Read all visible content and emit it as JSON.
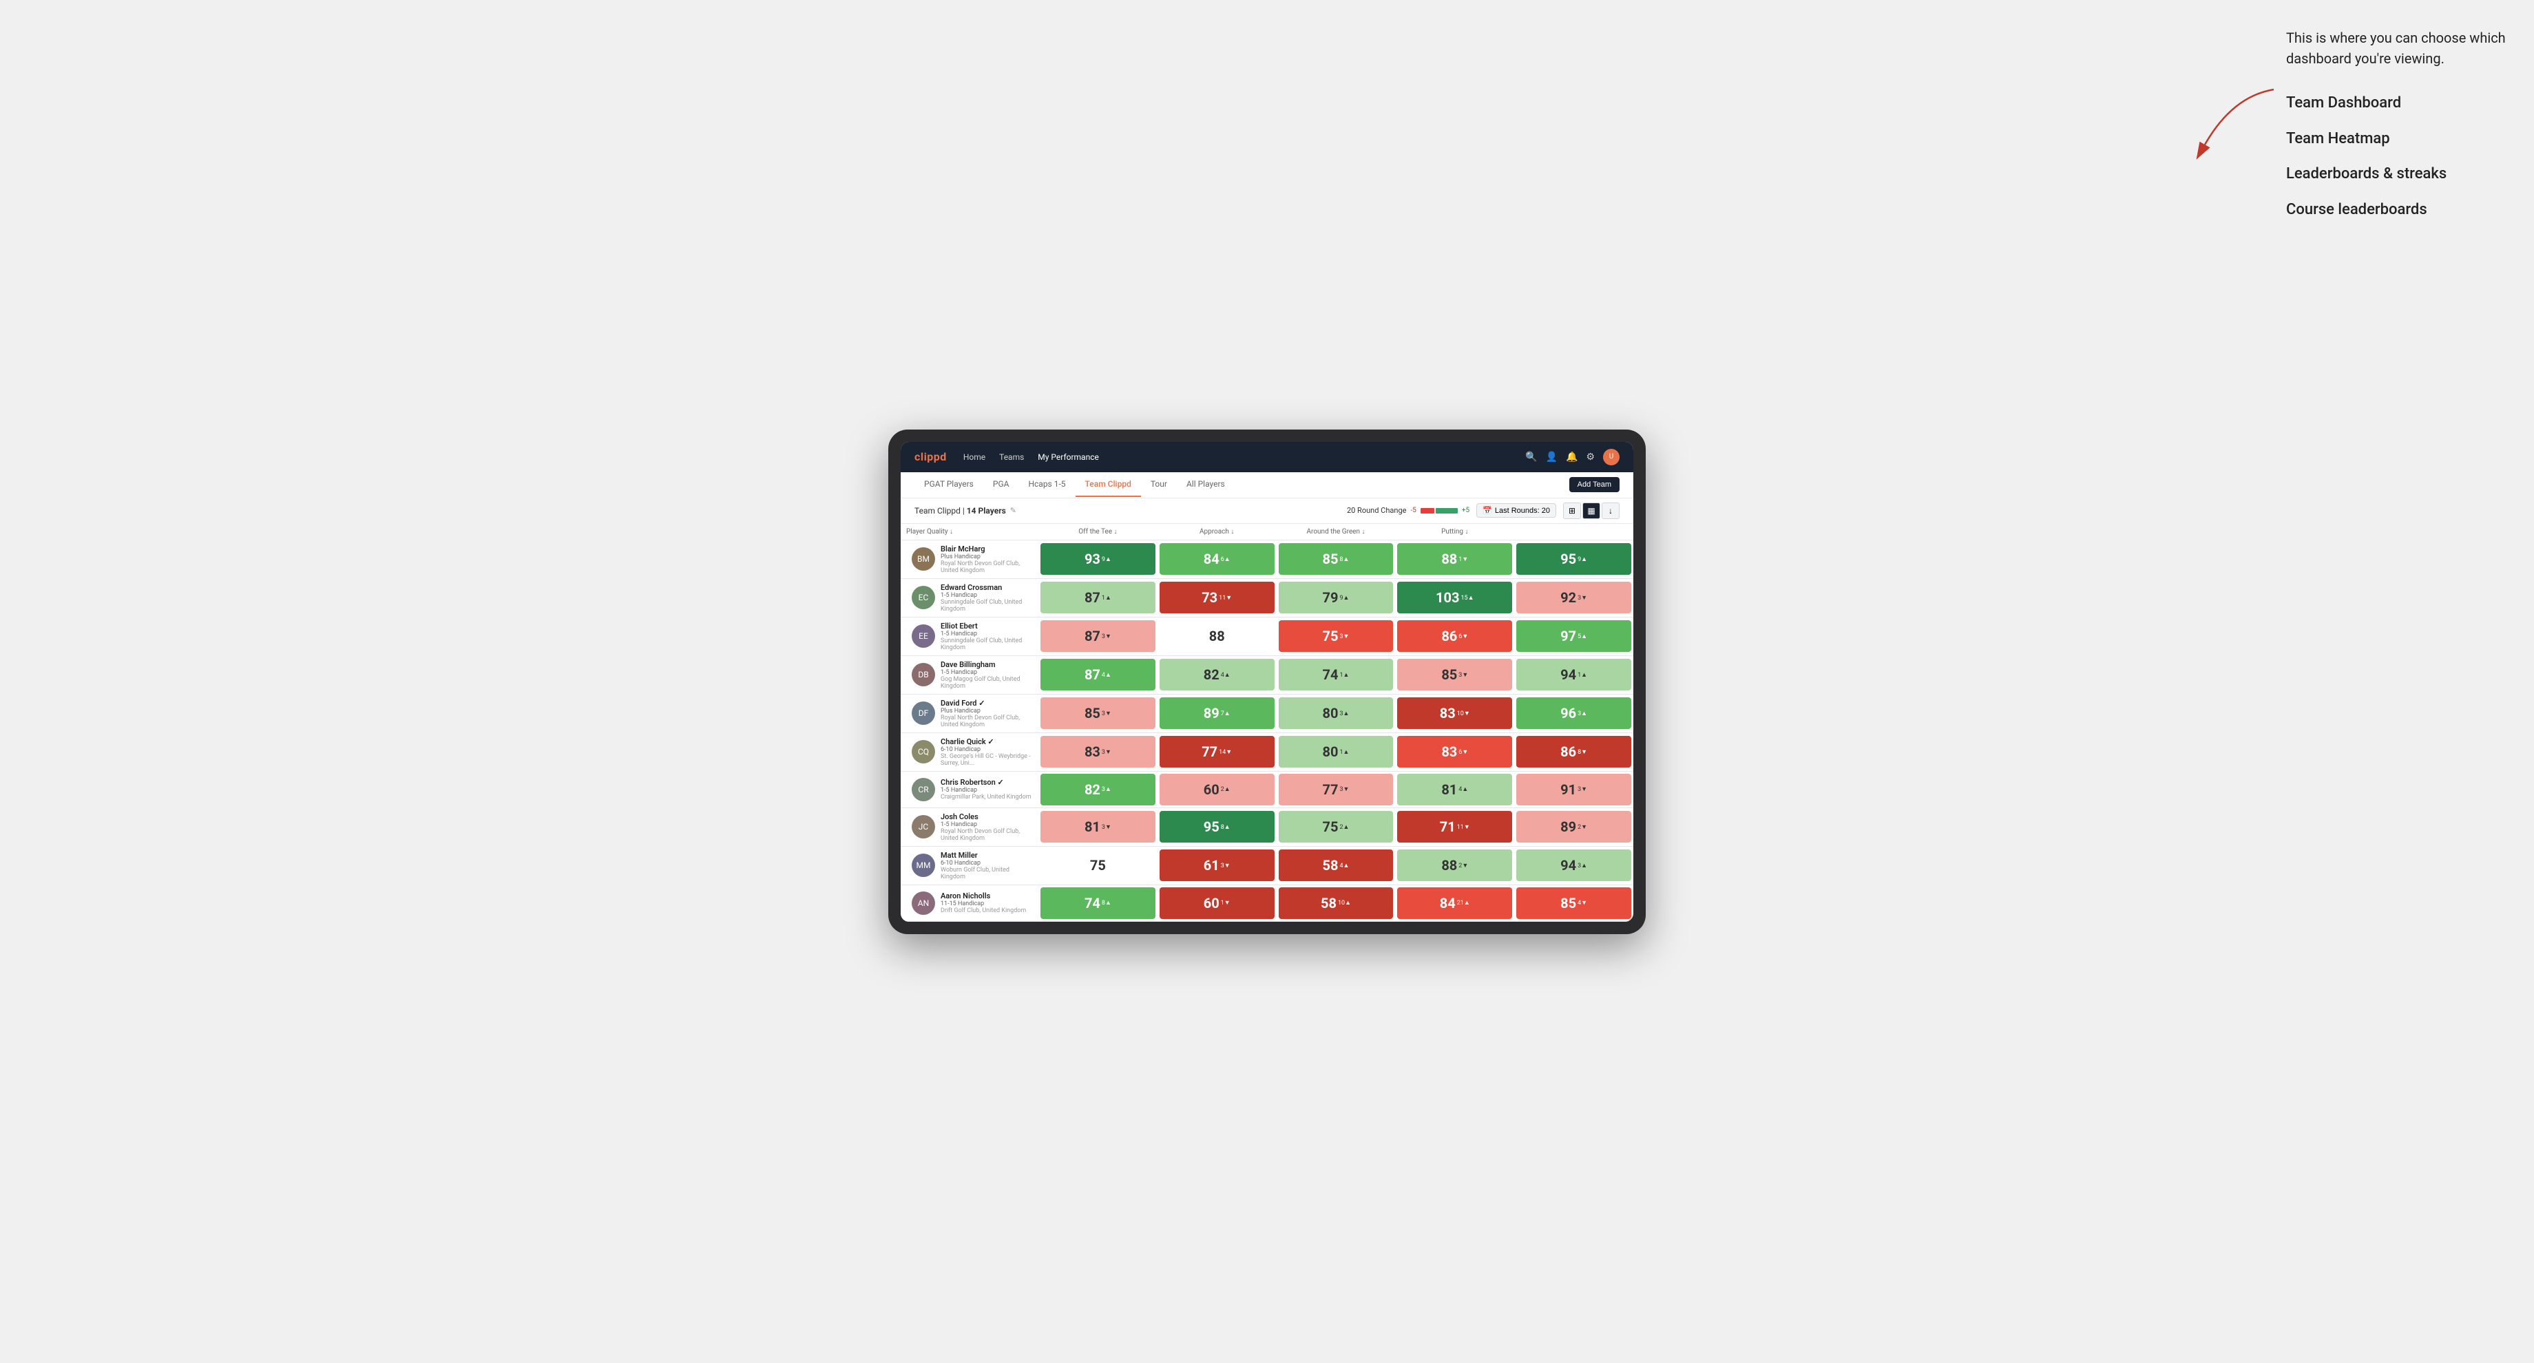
{
  "annotation": {
    "intro": "This is where you can choose which dashboard you're viewing.",
    "items": [
      "Team Dashboard",
      "Team Heatmap",
      "Leaderboards & streaks",
      "Course leaderboards"
    ]
  },
  "nav": {
    "logo": "clippd",
    "links": [
      "Home",
      "Teams",
      "My Performance"
    ],
    "active_link": "My Performance"
  },
  "sub_nav": {
    "tabs": [
      "PGAT Players",
      "PGA",
      "Hcaps 1-5",
      "Team Clippd",
      "Tour",
      "All Players"
    ],
    "active_tab": "Team Clippd",
    "add_team_label": "Add Team"
  },
  "team_info": {
    "name": "Team Clippd",
    "player_count": "14 Players",
    "round_change_label": "20 Round Change",
    "change_neg": "-5",
    "change_pos": "+5",
    "last_rounds_label": "Last Rounds:",
    "last_rounds_value": "20"
  },
  "table": {
    "columns": [
      "Player Quality ↓",
      "Off the Tee ↓",
      "Approach ↓",
      "Around the Green ↓",
      "Putting ↓"
    ],
    "rows": [
      {
        "name": "Blair McHarg",
        "handicap": "Plus Handicap",
        "club": "Royal North Devon Golf Club, United Kingdom",
        "scores": [
          {
            "value": "93",
            "change": "9▲",
            "bg": "bg-green-dark"
          },
          {
            "value": "84",
            "change": "6▲",
            "bg": "bg-green"
          },
          {
            "value": "85",
            "change": "8▲",
            "bg": "bg-green"
          },
          {
            "value": "88",
            "change": "1▼",
            "bg": "bg-green"
          },
          {
            "value": "95",
            "change": "9▲",
            "bg": "bg-green-dark"
          }
        ]
      },
      {
        "name": "Edward Crossman",
        "handicap": "1-5 Handicap",
        "club": "Sunningdale Golf Club, United Kingdom",
        "scores": [
          {
            "value": "87",
            "change": "1▲",
            "bg": "bg-green-light"
          },
          {
            "value": "73",
            "change": "11▼",
            "bg": "bg-red-dark"
          },
          {
            "value": "79",
            "change": "9▲",
            "bg": "bg-green-light"
          },
          {
            "value": "103",
            "change": "15▲",
            "bg": "bg-green-dark"
          },
          {
            "value": "92",
            "change": "3▼",
            "bg": "bg-red-light"
          }
        ]
      },
      {
        "name": "Elliot Ebert",
        "handicap": "1-5 Handicap",
        "club": "Sunningdale Golf Club, United Kingdom",
        "scores": [
          {
            "value": "87",
            "change": "3▼",
            "bg": "bg-red-light"
          },
          {
            "value": "88",
            "change": "",
            "bg": "bg-white"
          },
          {
            "value": "75",
            "change": "3▼",
            "bg": "bg-red"
          },
          {
            "value": "86",
            "change": "6▼",
            "bg": "bg-red"
          },
          {
            "value": "97",
            "change": "5▲",
            "bg": "bg-green"
          }
        ]
      },
      {
        "name": "Dave Billingham",
        "handicap": "1-5 Handicap",
        "club": "Gog Magog Golf Club, United Kingdom",
        "scores": [
          {
            "value": "87",
            "change": "4▲",
            "bg": "bg-green"
          },
          {
            "value": "82",
            "change": "4▲",
            "bg": "bg-green-light"
          },
          {
            "value": "74",
            "change": "1▲",
            "bg": "bg-green-light"
          },
          {
            "value": "85",
            "change": "3▼",
            "bg": "bg-red-light"
          },
          {
            "value": "94",
            "change": "1▲",
            "bg": "bg-green-light"
          }
        ]
      },
      {
        "name": "David Ford",
        "handicap": "Plus Handicap",
        "club": "Royal North Devon Golf Club, United Kingdom",
        "verified": true,
        "scores": [
          {
            "value": "85",
            "change": "3▼",
            "bg": "bg-red-light"
          },
          {
            "value": "89",
            "change": "7▲",
            "bg": "bg-green"
          },
          {
            "value": "80",
            "change": "3▲",
            "bg": "bg-green-light"
          },
          {
            "value": "83",
            "change": "10▼",
            "bg": "bg-red-dark"
          },
          {
            "value": "96",
            "change": "3▲",
            "bg": "bg-green"
          }
        ]
      },
      {
        "name": "Charlie Quick",
        "handicap": "6-10 Handicap",
        "club": "St. George's Hill GC - Weybridge - Surrey, Uni...",
        "verified": true,
        "scores": [
          {
            "value": "83",
            "change": "3▼",
            "bg": "bg-red-light"
          },
          {
            "value": "77",
            "change": "14▼",
            "bg": "bg-red-dark"
          },
          {
            "value": "80",
            "change": "1▲",
            "bg": "bg-green-light"
          },
          {
            "value": "83",
            "change": "6▼",
            "bg": "bg-red"
          },
          {
            "value": "86",
            "change": "8▼",
            "bg": "bg-red-dark"
          }
        ]
      },
      {
        "name": "Chris Robertson",
        "handicap": "1-5 Handicap",
        "club": "Craigmillar Park, United Kingdom",
        "verified": true,
        "scores": [
          {
            "value": "82",
            "change": "3▲",
            "bg": "bg-green"
          },
          {
            "value": "60",
            "change": "2▲",
            "bg": "bg-red-light"
          },
          {
            "value": "77",
            "change": "3▼",
            "bg": "bg-red-light"
          },
          {
            "value": "81",
            "change": "4▲",
            "bg": "bg-green-light"
          },
          {
            "value": "91",
            "change": "3▼",
            "bg": "bg-red-light"
          }
        ]
      },
      {
        "name": "Josh Coles",
        "handicap": "1-5 Handicap",
        "club": "Royal North Devon Golf Club, United Kingdom",
        "scores": [
          {
            "value": "81",
            "change": "3▼",
            "bg": "bg-red-light"
          },
          {
            "value": "95",
            "change": "8▲",
            "bg": "bg-green-dark"
          },
          {
            "value": "75",
            "change": "2▲",
            "bg": "bg-green-light"
          },
          {
            "value": "71",
            "change": "11▼",
            "bg": "bg-red-dark"
          },
          {
            "value": "89",
            "change": "2▼",
            "bg": "bg-red-light"
          }
        ]
      },
      {
        "name": "Matt Miller",
        "handicap": "6-10 Handicap",
        "club": "Woburn Golf Club, United Kingdom",
        "scores": [
          {
            "value": "75",
            "change": "",
            "bg": "bg-white"
          },
          {
            "value": "61",
            "change": "3▼",
            "bg": "bg-red-dark"
          },
          {
            "value": "58",
            "change": "4▲",
            "bg": "bg-red-dark"
          },
          {
            "value": "88",
            "change": "2▼",
            "bg": "bg-green-light"
          },
          {
            "value": "94",
            "change": "3▲",
            "bg": "bg-green-light"
          }
        ]
      },
      {
        "name": "Aaron Nicholls",
        "handicap": "11-15 Handicap",
        "club": "Drift Golf Club, United Kingdom",
        "scores": [
          {
            "value": "74",
            "change": "8▲",
            "bg": "bg-green"
          },
          {
            "value": "60",
            "change": "1▼",
            "bg": "bg-red-dark"
          },
          {
            "value": "58",
            "change": "10▲",
            "bg": "bg-red-dark"
          },
          {
            "value": "84",
            "change": "21▲",
            "bg": "bg-red"
          },
          {
            "value": "85",
            "change": "4▼",
            "bg": "bg-red"
          }
        ]
      }
    ]
  },
  "icons": {
    "search": "🔍",
    "user": "👤",
    "bell": "🔔",
    "settings": "⚙",
    "grid": "⊞",
    "heatmap": "▦",
    "download": "↓",
    "edit": "✎"
  }
}
